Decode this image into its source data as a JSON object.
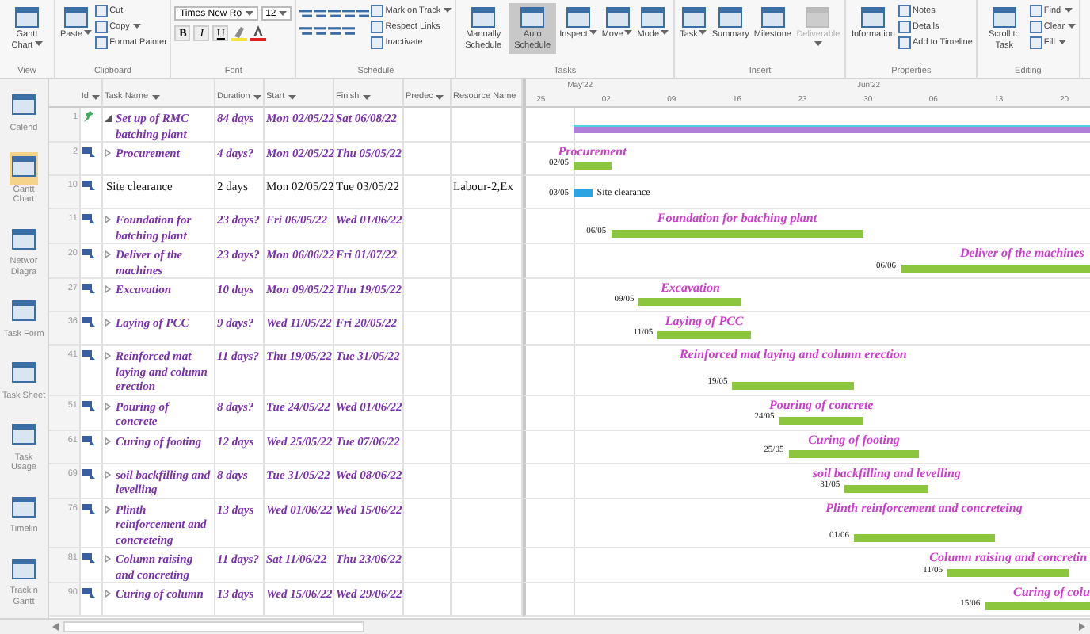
{
  "ribbon": {
    "groups": [
      {
        "label": "View",
        "large": [
          {
            "label": "Gantt Chart",
            "menu": true
          }
        ]
      },
      {
        "label": "Clipboard",
        "large": [
          {
            "label": "Paste",
            "menu": true
          }
        ],
        "small": [
          {
            "label": "Cut"
          },
          {
            "label": "Copy",
            "menu": true
          },
          {
            "label": "Format Painter"
          }
        ]
      },
      {
        "label": "Font",
        "font_name": "Times New Ro",
        "font_size": "12",
        "format": [
          "B",
          "I",
          "U"
        ]
      },
      {
        "label": "Schedule",
        "small": [
          {
            "label": "Mark on Track",
            "menu": true
          },
          {
            "label": "Respect Links"
          },
          {
            "label": "Inactivate"
          }
        ]
      },
      {
        "label": "Tasks",
        "large": [
          {
            "label": "Manually Schedule",
            "on": false
          },
          {
            "label": "Auto Schedule",
            "on": true
          },
          {
            "label": "Inspect",
            "menu": true
          },
          {
            "label": "Move",
            "menu": true
          },
          {
            "label": "Mode",
            "menu": true
          }
        ]
      },
      {
        "label": "Insert",
        "large": [
          {
            "label": "Task",
            "menu": true,
            "disabled": false
          },
          {
            "label": "Summary",
            "disabled": false
          },
          {
            "label": "Milestone",
            "disabled": false
          },
          {
            "label": "Deliverable",
            "menu": true,
            "disabled": true
          }
        ]
      },
      {
        "label": "Properties",
        "large": [
          {
            "label": "Information"
          }
        ],
        "small": [
          {
            "label": "Notes"
          },
          {
            "label": "Details"
          },
          {
            "label": "Add to Timeline"
          }
        ]
      },
      {
        "label": "Editing",
        "large": [
          {
            "label": "Scroll to Task"
          }
        ],
        "small": [
          {
            "label": "Find",
            "menu": true
          },
          {
            "label": "Clear",
            "menu": true
          },
          {
            "label": "Fill",
            "menu": true
          }
        ]
      }
    ]
  },
  "views": [
    {
      "label": "Calend",
      "selected": false
    },
    {
      "label": "Gantt Chart",
      "selected": true
    },
    {
      "label": "Networ Diagra",
      "selected": false
    },
    {
      "label": "Task Form",
      "selected": false
    },
    {
      "label": "Task Sheet",
      "selected": false
    },
    {
      "label": "Task Usage",
      "selected": false
    },
    {
      "label": "Timelin",
      "selected": false
    },
    {
      "label": "Trackin Gantt",
      "selected": false
    }
  ],
  "table": {
    "columns": [
      {
        "label": "Id",
        "menu": true
      },
      {
        "label": "Task Name",
        "menu": true
      },
      {
        "label": "Duration",
        "menu": true
      },
      {
        "label": "Start",
        "menu": true
      },
      {
        "label": "Finish",
        "menu": true
      },
      {
        "label": "Predec",
        "menu": true
      },
      {
        "label": "Resource Name",
        "menu": false
      }
    ]
  },
  "timescale": {
    "months": [
      "May'22",
      "Jun'22"
    ],
    "weeks": [
      "25",
      "02",
      "09",
      "16",
      "23",
      "30",
      "06",
      "13",
      "20"
    ]
  },
  "tasks": [
    {
      "id": "1",
      "kind": "summary",
      "manual": true,
      "expanded": true,
      "name": "Set up of RMC batching plant",
      "duration": "84 days",
      "start": "Mon 02/05/22",
      "finish": "Sat 06/08/22"
    },
    {
      "id": "2",
      "kind": "task",
      "manual": false,
      "expanded": false,
      "name": "Procurement",
      "duration": "4 days?",
      "start": "Mon 02/05/22",
      "finish": "Thu 05/05/22",
      "bar_label": "Procurement",
      "bar_date": "02/05"
    },
    {
      "id": "10",
      "kind": "plain",
      "manual": false,
      "name": "Site clearance",
      "duration": "2 days",
      "start": "Mon 02/05/22",
      "finish": "Tue 03/05/22",
      "resource": "Labour-2,Ex",
      "bar_label": "Site clearance",
      "bar_date": "03/05"
    },
    {
      "id": "11",
      "kind": "task",
      "manual": false,
      "expanded": false,
      "name": "Foundation for batching plant",
      "duration": "23 days?",
      "start": "Fri 06/05/22",
      "finish": "Wed 01/06/22",
      "bar_label": "Foundation for  batching plant",
      "bar_date": "06/05"
    },
    {
      "id": "20",
      "kind": "task",
      "manual": false,
      "expanded": false,
      "name": "Deliver of the machines",
      "duration": "23 days?",
      "start": "Mon 06/06/22",
      "finish": "Fri 01/07/22",
      "bar_label": "Deliver of the machines",
      "bar_date": "06/06"
    },
    {
      "id": "27",
      "kind": "task",
      "manual": false,
      "expanded": false,
      "name": "Excavation",
      "duration": "10 days",
      "start": "Mon 09/05/22",
      "finish": "Thu 19/05/22",
      "bar_label": "Excavation",
      "bar_date": "09/05"
    },
    {
      "id": "36",
      "kind": "task",
      "manual": false,
      "expanded": false,
      "name": "Laying of PCC",
      "duration": "9 days?",
      "start": "Wed 11/05/22",
      "finish": "Fri 20/05/22",
      "bar_label": "Laying of PCC",
      "bar_date": "11/05"
    },
    {
      "id": "41",
      "kind": "task",
      "manual": false,
      "expanded": false,
      "name": "Reinforced mat laying and column erection",
      "duration": "11 days?",
      "start": "Thu 19/05/22",
      "finish": "Tue 31/05/22",
      "bar_label": "Reinforced mat laying and column erection",
      "bar_date": "19/05"
    },
    {
      "id": "51",
      "kind": "task",
      "manual": false,
      "expanded": false,
      "name": "Pouring of concrete",
      "duration": "8 days?",
      "start": "Tue 24/05/22",
      "finish": "Wed 01/06/22",
      "bar_label": "Pouring of concrete",
      "bar_date": "24/05"
    },
    {
      "id": "61",
      "kind": "task",
      "manual": false,
      "expanded": false,
      "name": "Curing of footing",
      "duration": "12 days",
      "start": "Wed 25/05/22",
      "finish": "Tue 07/06/22",
      "bar_label": "Curing of footing",
      "bar_date": "25/05"
    },
    {
      "id": "69",
      "kind": "task",
      "manual": false,
      "expanded": false,
      "name": "soil backfilling and levelling",
      "duration": "8 days",
      "start": "Tue 31/05/22",
      "finish": "Wed 08/06/22",
      "bar_label": "soil backfilling and levelling",
      "bar_date": "31/05"
    },
    {
      "id": "76",
      "kind": "task",
      "manual": false,
      "expanded": false,
      "name": "Plinth reinforcement and concreteing",
      "duration": "13 days",
      "start": "Wed 01/06/22",
      "finish": "Wed 15/06/22",
      "bar_label": "Plinth reinforcement and concreteing",
      "bar_date": "01/06"
    },
    {
      "id": "81",
      "kind": "task",
      "manual": false,
      "expanded": false,
      "name": "Column raising and concreting",
      "duration": "11 days?",
      "start": "Sat 11/06/22",
      "finish": "Thu 23/06/22",
      "bar_label": "Column raising and concretin",
      "bar_date": "11/06"
    },
    {
      "id": "90",
      "kind": "task",
      "manual": false,
      "expanded": false,
      "name": "Curing of column",
      "duration": "13 days",
      "start": "Wed 15/06/22",
      "finish": "Wed 29/06/22",
      "bar_label": "Curing of colu",
      "bar_date": "15/06"
    }
  ]
}
